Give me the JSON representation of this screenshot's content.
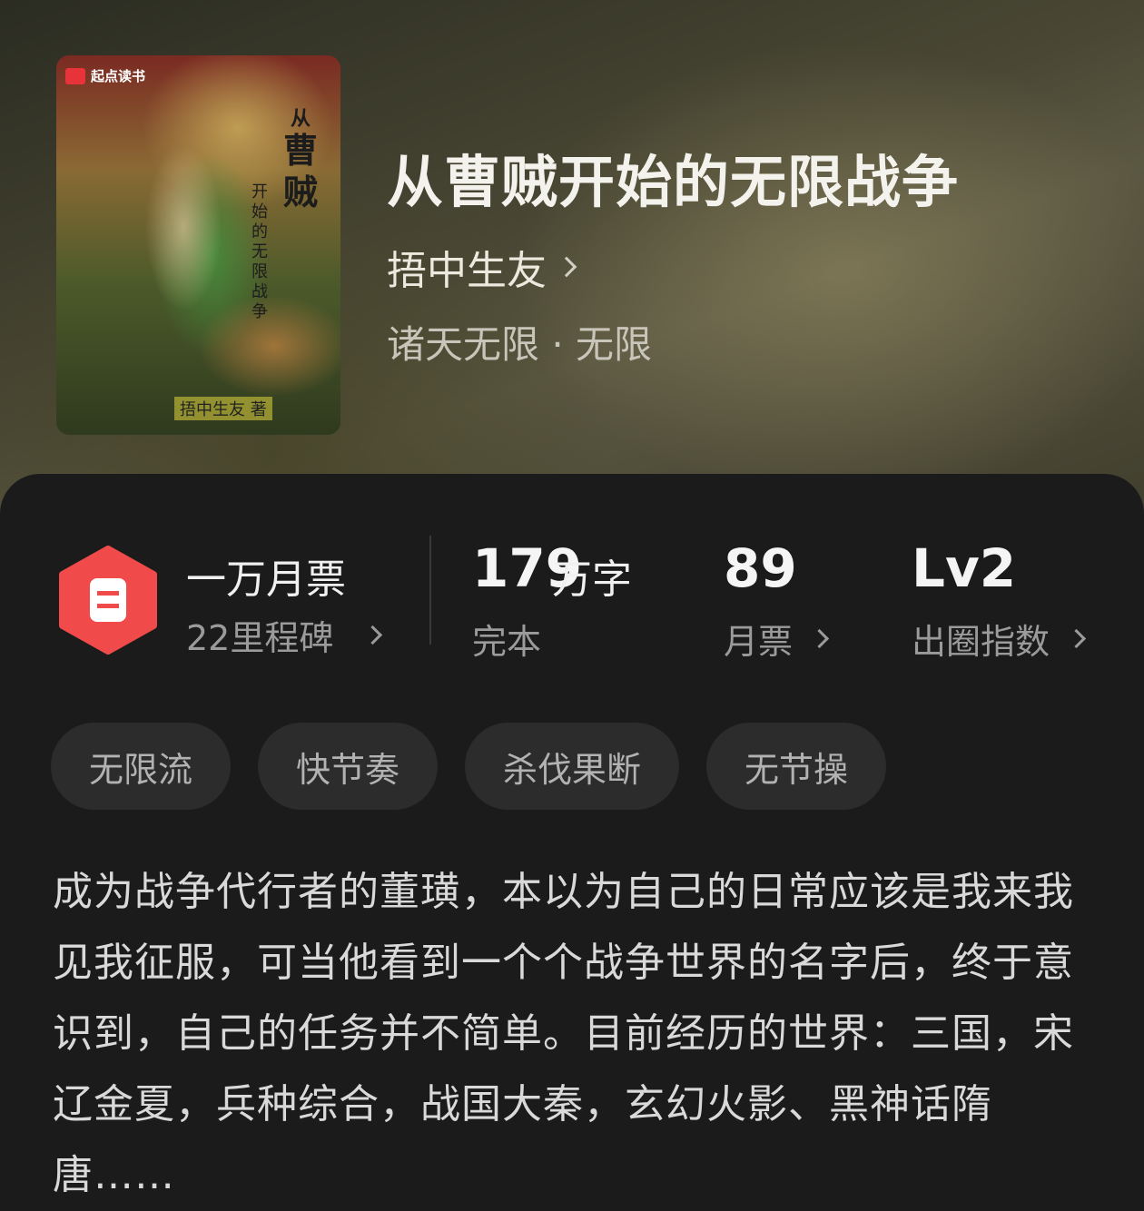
{
  "book": {
    "cover": {
      "brand": "起点读书",
      "title_big": "曹贼",
      "title_prefix": "从",
      "title_small": "开始的无限战争",
      "author_tag": "捂中生友 著"
    },
    "title": "从曹贼开始的无限战争",
    "author": "捂中生友",
    "genre": "诸天无限 · 无限"
  },
  "stats": {
    "award_title": "一万月票",
    "award_sub": "22里程碑",
    "words_value": "179",
    "words_unit": "万字",
    "words_status": "完本",
    "ticket_value": "89",
    "ticket_label": "月票",
    "level_value": "Lv2",
    "level_label": "出圈指数"
  },
  "tags": [
    "无限流",
    "快节奏",
    "杀伐果断",
    "无节操"
  ],
  "description": "成为战争代行者的董璜，本以为自己的日常应该是我来我见我征服，可当他看到一个个战争世界的名字后，终于意识到，自己的任务并不简单。目前经历的世界：三国，宋辽金夏，兵种综合，战国大秦，玄幻火影、黑神话隋唐……",
  "colors": {
    "badge_red": "#f04a4a",
    "panel_bg": "#1b1b1b",
    "tag_bg": "#2c2c2c"
  }
}
